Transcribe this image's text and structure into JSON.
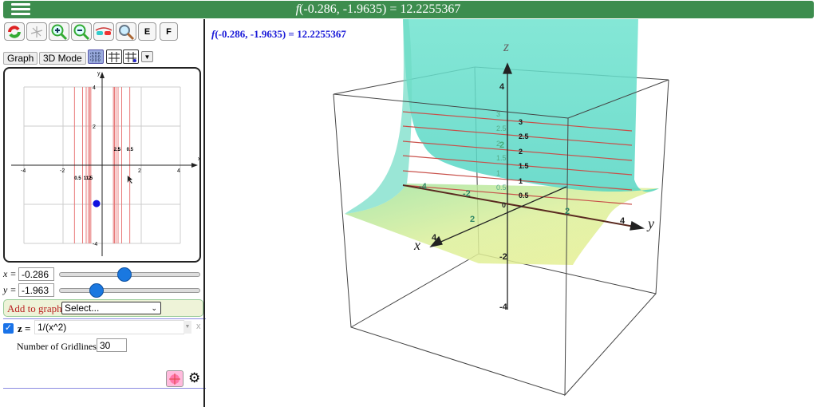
{
  "header": {
    "title_func": "f",
    "title_rest": "(-0.286, -1.9635) = 12.2255367"
  },
  "toolbar": {
    "buttons": [
      {
        "name": "reset-view-icon"
      },
      {
        "name": "axes-icon"
      },
      {
        "name": "zoom-in-icon"
      },
      {
        "name": "zoom-out-icon"
      },
      {
        "name": "3d-glasses-icon"
      },
      {
        "name": "search-icon"
      },
      {
        "name": "e-button",
        "label": "E"
      },
      {
        "name": "f-button",
        "label": "F"
      }
    ]
  },
  "modes": {
    "graph": "Graph",
    "mode3d": "3D Mode"
  },
  "graph2d": {
    "ticks": [
      "-4",
      "-2",
      "2",
      "4"
    ],
    "yticks": [
      "4",
      "2",
      "-4"
    ],
    "xlabel": "x",
    "ylabel": "y",
    "contour_levels": [
      0.5,
      1,
      1.5,
      2,
      2.5,
      3
    ],
    "contour_labels_left": [
      "0.5",
      "11.5",
      "2"
    ],
    "contour_labels_right": [
      "2.5",
      "5",
      "0.5"
    ],
    "point": {
      "x": -0.286,
      "y": -1.963
    },
    "point_color": "#1010e0"
  },
  "controls": {
    "x_label": "x =",
    "x_value": "-0.286",
    "y_label": "y =",
    "y_value": "-1.963"
  },
  "add": {
    "label": "Add to graph:",
    "select": "Select..."
  },
  "expression": {
    "checked": true,
    "lhs": "z =",
    "value": "1/(x^2)",
    "remove": "x",
    "gridlines_label": "Number of Gridlines",
    "gridlines_value": "30"
  },
  "view3d": {
    "readout_func": "f",
    "readout_rest": "(-0.286, -1.9635) = 12.2255367",
    "axis_x": "x",
    "axis_y": "y",
    "axis_z": "z",
    "z_ticks": [
      "4",
      "2",
      "-2",
      "-4"
    ],
    "y_ticks": [
      "-4",
      "-2",
      "2",
      "4"
    ],
    "x_ticks": [
      "2",
      "4"
    ],
    "origin": "0",
    "contour_labels": [
      "3",
      "2.5",
      "2",
      "1.5",
      "1",
      "0.5"
    ],
    "back_labels": [
      "3",
      "2.5",
      "2",
      "1.5",
      "1",
      "0.5"
    ]
  }
}
